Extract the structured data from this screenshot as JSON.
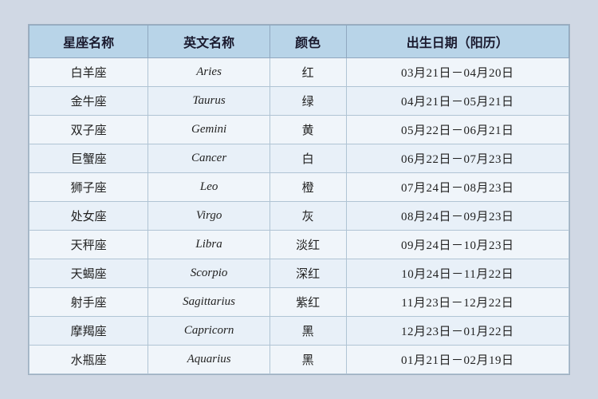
{
  "table": {
    "headers": [
      "星座名称",
      "英文名称",
      "颜色",
      "出生日期（阳历）"
    ],
    "rows": [
      {
        "zh": "白羊座",
        "en": "Aries",
        "color": "红",
        "dates": "03月21日－04月20日"
      },
      {
        "zh": "金牛座",
        "en": "Taurus",
        "color": "绿",
        "dates": "04月21日－05月21日"
      },
      {
        "zh": "双子座",
        "en": "Gemini",
        "color": "黄",
        "dates": "05月22日－06月21日"
      },
      {
        "zh": "巨蟹座",
        "en": "Cancer",
        "color": "白",
        "dates": "06月22日－07月23日"
      },
      {
        "zh": "狮子座",
        "en": "Leo",
        "color": "橙",
        "dates": "07月24日－08月23日"
      },
      {
        "zh": "处女座",
        "en": "Virgo",
        "color": "灰",
        "dates": "08月24日－09月23日"
      },
      {
        "zh": "天秤座",
        "en": "Libra",
        "color": "淡红",
        "dates": "09月24日－10月23日"
      },
      {
        "zh": "天蝎座",
        "en": "Scorpio",
        "color": "深红",
        "dates": "10月24日－11月22日"
      },
      {
        "zh": "射手座",
        "en": "Sagittarius",
        "color": "紫红",
        "dates": "11月23日－12月22日"
      },
      {
        "zh": "摩羯座",
        "en": "Capricorn",
        "color": "黑",
        "dates": "12月23日－01月22日"
      },
      {
        "zh": "水瓶座",
        "en": "Aquarius",
        "color": "黑",
        "dates": "01月21日－02月19日"
      }
    ]
  }
}
